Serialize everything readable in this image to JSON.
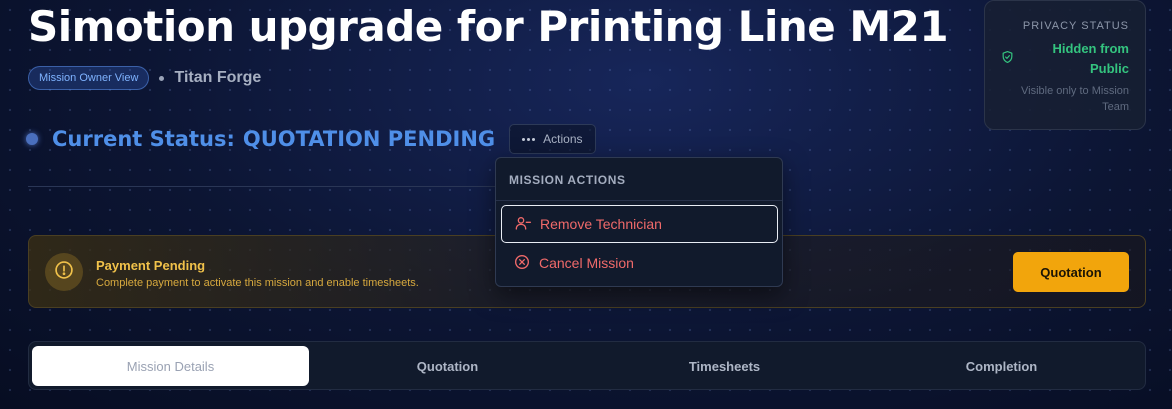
{
  "header": {
    "title": "Simotion upgrade for Printing Line M21",
    "badge": "Mission Owner View",
    "organization": "Titan Forge"
  },
  "status": {
    "prefix": "Current Status:",
    "value": "QUOTATION PENDING",
    "actions_label": "Actions"
  },
  "privacy": {
    "heading": "PRIVACY STATUS",
    "state": "Hidden from Public",
    "note": "Visible only to Mission Team",
    "state_color": "#34c47f"
  },
  "actions_menu": {
    "heading": "MISSION ACTIONS",
    "items": [
      {
        "label": "Remove Technician",
        "icon": "user-minus-icon"
      },
      {
        "label": "Cancel Mission",
        "icon": "x-circle-icon"
      }
    ],
    "danger_color": "#f06a6a"
  },
  "payment": {
    "title": "Payment Pending",
    "description": "Complete payment to activate this mission and enable timesheets.",
    "button_label": "Quotation",
    "accent_color": "#f2a50c"
  },
  "tabs": [
    {
      "label": "Mission Details",
      "active": true
    },
    {
      "label": "Quotation",
      "active": false
    },
    {
      "label": "Timesheets",
      "active": false
    },
    {
      "label": "Completion",
      "active": false
    }
  ]
}
